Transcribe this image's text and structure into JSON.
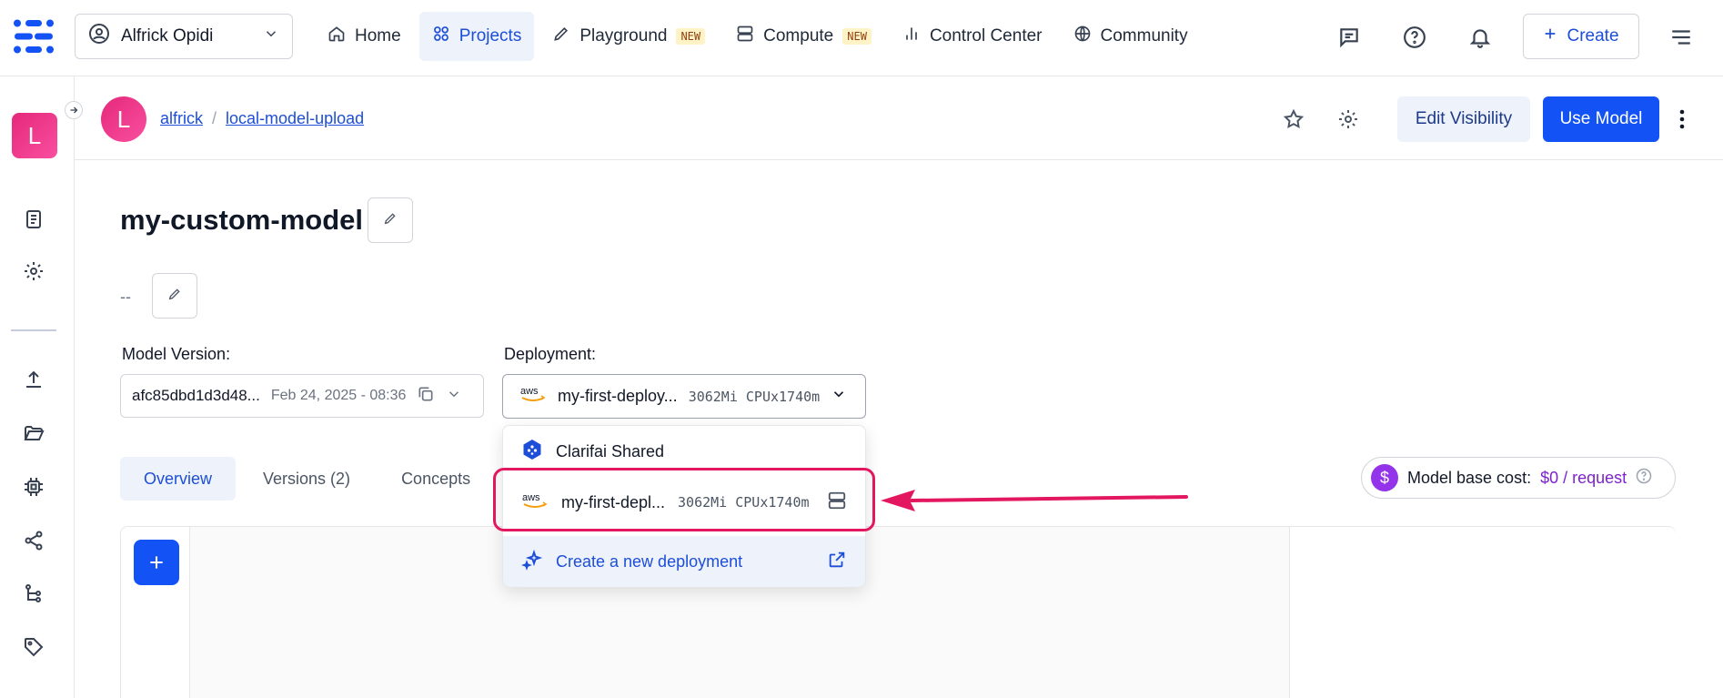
{
  "nav": {
    "user_name": "Alfrick Opidi",
    "items": [
      {
        "label": "Home",
        "icon": "home-icon"
      },
      {
        "label": "Projects",
        "icon": "grid-icon"
      },
      {
        "label": "Playground",
        "icon": "pencil-icon",
        "badge": "NEW"
      },
      {
        "label": "Compute",
        "icon": "server-icon",
        "badge": "NEW"
      },
      {
        "label": "Control Center",
        "icon": "bar-chart-icon"
      },
      {
        "label": "Community",
        "icon": "globe-icon"
      }
    ],
    "active": "Projects",
    "create_label": "Create"
  },
  "sidebar": {
    "avatar_letter": "L"
  },
  "breadcrumb": {
    "avatar_letter": "L",
    "user": "alfrick",
    "separator": "/",
    "app": "local-model-upload",
    "edit_visibility_label": "Edit Visibility",
    "use_model_label": "Use Model"
  },
  "model": {
    "title": "my-custom-model",
    "description": "--",
    "version_label": "Model Version:",
    "version_id": "afc85dbd1d3d48...",
    "version_date": "Feb 24, 2025 - 08:36",
    "deployment_label": "Deployment:",
    "deployment_name": "my-first-deploy...",
    "deployment_specs": "3062Mi CPUx1740m"
  },
  "tabs": [
    {
      "label": "Overview"
    },
    {
      "label": "Versions (2)"
    },
    {
      "label": "Concepts"
    }
  ],
  "tab_cut_glyph": "L",
  "cost": {
    "label": "Model base cost:",
    "value": "$0 / request"
  },
  "dropdown": {
    "shared_label": "Clarifai Shared",
    "deployment_name": "my-first-depl...",
    "deployment_specs": "3062Mi CPUx1740m",
    "create_label": "Create a new deployment"
  },
  "colors": {
    "primary": "#1352f5",
    "accent_pink": "#e3175f",
    "avatar_pink": "#e5287a",
    "cost_purple": "#7e22ce"
  }
}
